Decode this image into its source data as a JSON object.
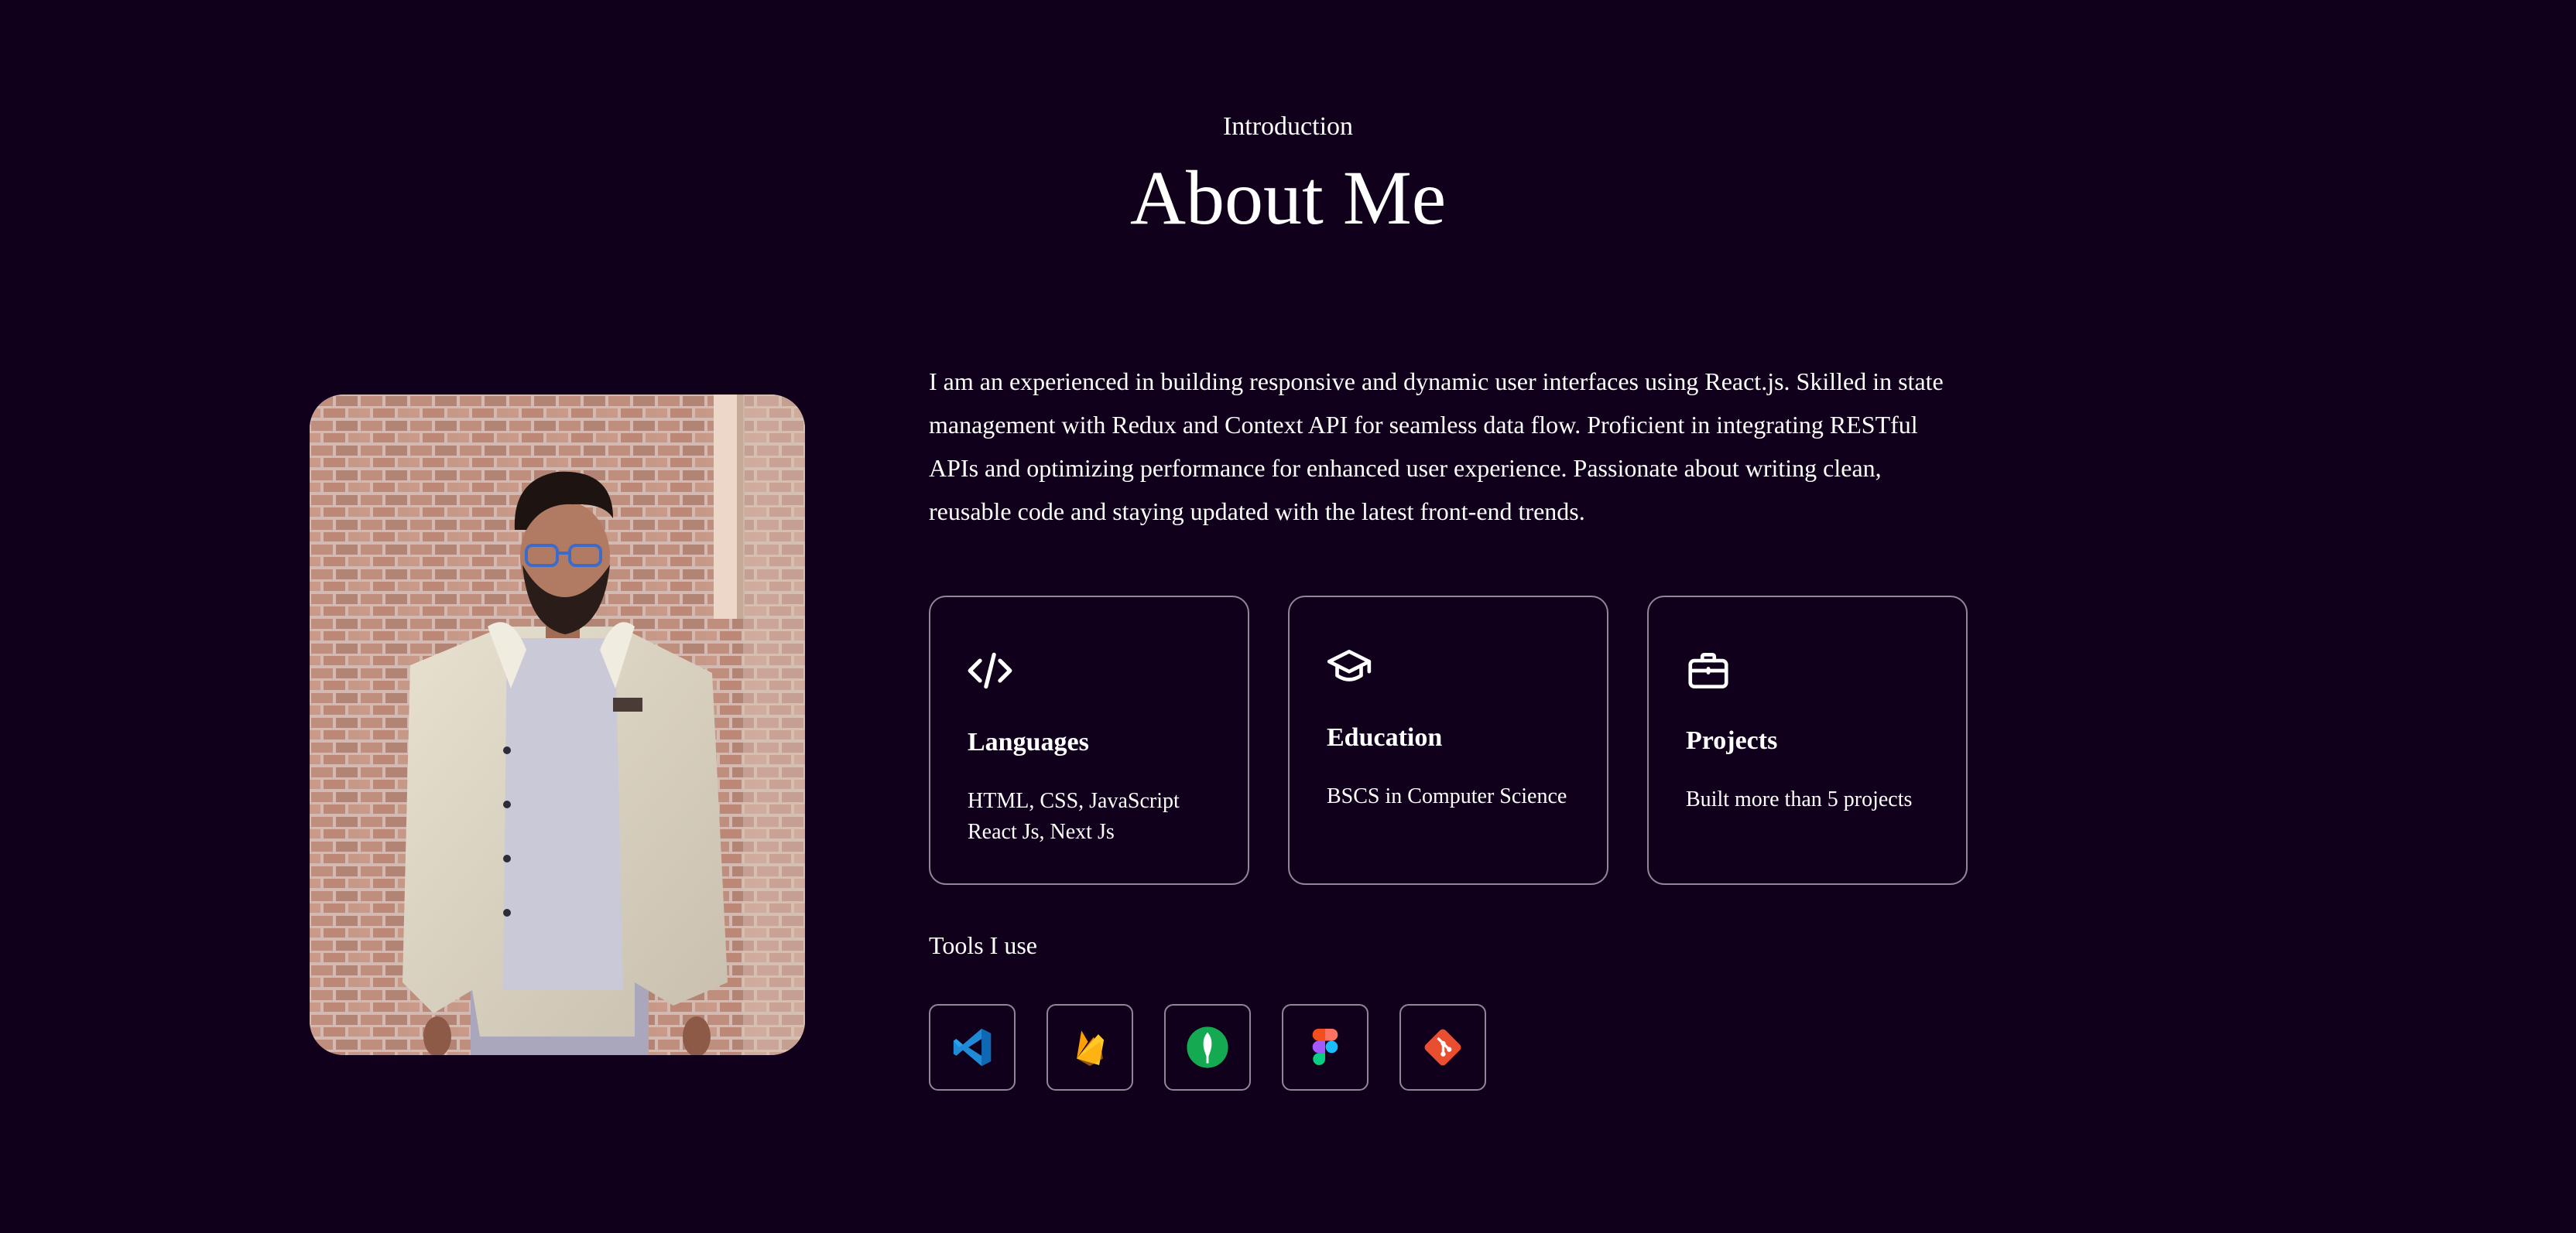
{
  "header": {
    "intro": "Introduction",
    "title": "About Me"
  },
  "bio": "I am an experienced in building responsive and dynamic user interfaces using React.js. Skilled in state management with Redux and Context API for seamless data flow. Proficient in integrating RESTful APIs and optimizing performance for enhanced user experience. Passionate about writing clean, reusable code and staying updated with the latest front-end trends.",
  "cards": [
    {
      "icon": "code-icon",
      "title": "Languages",
      "lines": [
        "HTML, CSS, JavaScript",
        "React Js, Next Js"
      ]
    },
    {
      "icon": "graduation-cap-icon",
      "title": "Education",
      "lines": [
        "BSCS in Computer Science"
      ]
    },
    {
      "icon": "briefcase-icon",
      "title": "Projects",
      "lines": [
        "Built more than 5 projects"
      ]
    }
  ],
  "tools": {
    "heading": "Tools I use",
    "items": [
      {
        "icon": "vscode-icon"
      },
      {
        "icon": "firebase-icon"
      },
      {
        "icon": "mongodb-icon"
      },
      {
        "icon": "figma-icon"
      },
      {
        "icon": "git-icon"
      }
    ]
  },
  "colors": {
    "background": "#11001c",
    "text": "#ffffff",
    "card_border": "#8f8698"
  }
}
